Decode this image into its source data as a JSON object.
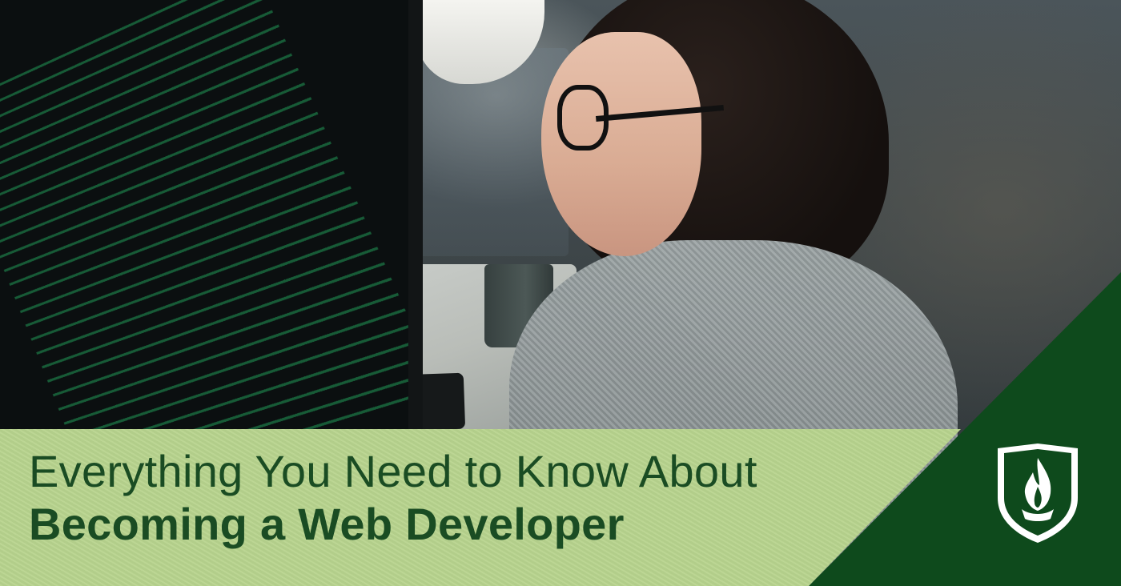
{
  "banner": {
    "headline_line1": "Everything You Need to Know About",
    "headline_line2": "Becoming a Web Developer"
  },
  "photo": {
    "subject": "woman with glasses looking at a monitor displaying code"
  },
  "logo": {
    "icon": "flame-shield-icon"
  },
  "colors": {
    "title_text": "#1a4c23",
    "title_panel": "#b8d48e",
    "accent_green": "#0e4a1c",
    "code_green": "#28c86e"
  }
}
